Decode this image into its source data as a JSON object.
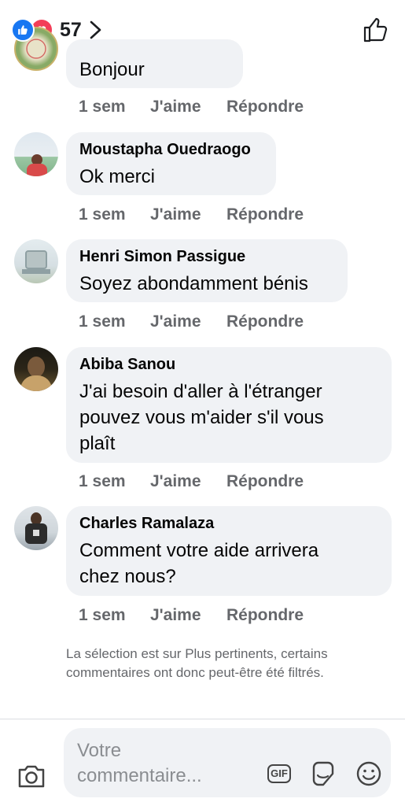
{
  "header": {
    "reaction_count": "57",
    "reaction_icons": [
      "like-icon",
      "love-icon"
    ],
    "chevron_icon": "chevron-right-icon",
    "like_button_icon": "thumbs-up-outline-icon"
  },
  "comments": [
    {
      "author": "",
      "text": "Bonjour",
      "time": "1 sem",
      "like_label": "J'aime",
      "reply_label": "Répondre"
    },
    {
      "author": "Moustapha Ouedraogo",
      "text": "Ok merci",
      "time": "1 sem",
      "like_label": "J'aime",
      "reply_label": "Répondre"
    },
    {
      "author": "Henri Simon Passigue",
      "text": "Soyez abondamment bénis",
      "time": "1 sem",
      "like_label": "J'aime",
      "reply_label": "Répondre"
    },
    {
      "author": "Abiba Sanou",
      "text": "J'ai besoin d'aller à l'étranger pouvez vous m'aider s'il vous plaît",
      "time": "1 sem",
      "like_label": "J'aime",
      "reply_label": "Répondre"
    },
    {
      "author": "Charles Ramalaza",
      "text": "Comment votre aide arrivera chez nous?",
      "time": "1 sem",
      "like_label": "J'aime",
      "reply_label": "Répondre"
    }
  ],
  "filter_note": "La sélection est sur Plus pertinents, certains commentaires ont donc peut-être été filtrés.",
  "composer": {
    "placeholder": "Votre commentaire...",
    "gif_label": "GIF",
    "icons": [
      "camera-icon",
      "gif-icon",
      "sticker-icon",
      "emoji-icon"
    ]
  },
  "colors": {
    "like_blue": "#1877f2",
    "love_red": "#f33e58",
    "bubble_bg": "#f0f2f5",
    "meta_gray": "#65676b"
  }
}
